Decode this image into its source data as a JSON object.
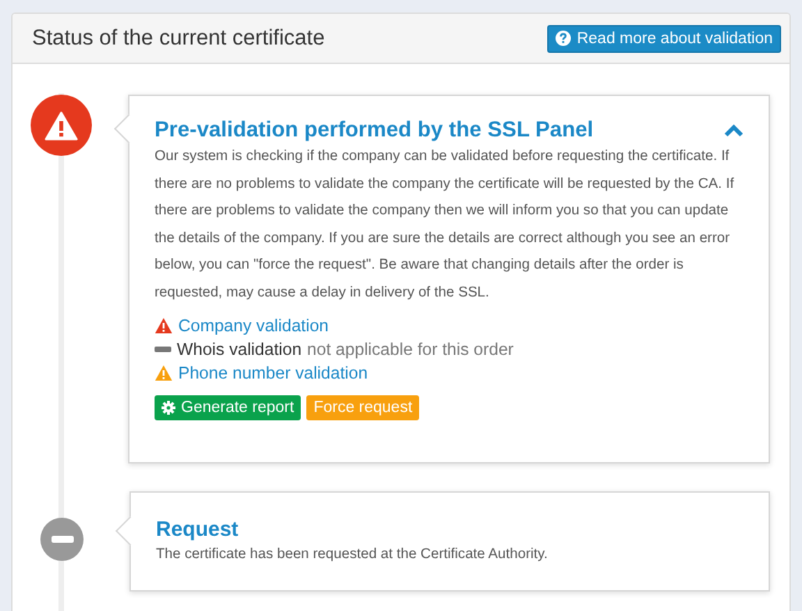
{
  "panel": {
    "title": "Status of the current certificate",
    "help_button": "Read more about validation"
  },
  "steps": [
    {
      "kind": "error",
      "title": "Pre-validation performed by the SSL Panel",
      "expanded": true,
      "description": "Our system is checking if the company can be validated before requesting the certificate. If there are no problems to validate the company the certificate will be requested by the CA. If there are problems to validate the company then we will inform you so that you can update the details of the company. If you are sure the details are correct although you see an error below, you can \"force the request\". Be aware that changing details after the order is requested, may cause a delay in delivery of the SSL.",
      "checks": [
        {
          "kind": "error",
          "label": "Company validation"
        },
        {
          "kind": "na",
          "label": "Whois validation",
          "note": "not applicable for this order"
        },
        {
          "kind": "warning",
          "label": "Phone number validation"
        }
      ],
      "buttons": [
        {
          "kind": "success",
          "label": "Generate report"
        },
        {
          "kind": "warning",
          "label": "Force request"
        }
      ]
    },
    {
      "kind": "neutral",
      "title": "Request",
      "description": "The certificate has been requested at the Certificate Authority."
    }
  ]
}
